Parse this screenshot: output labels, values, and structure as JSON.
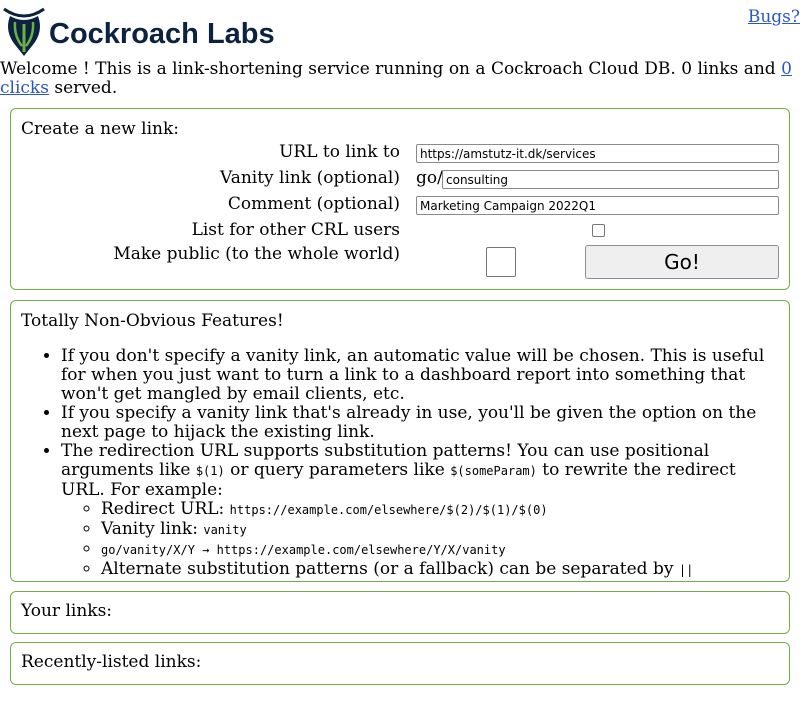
{
  "header": {
    "logo_text": "Cockroach Labs",
    "bugs_link": "Bugs?"
  },
  "welcome": {
    "text_before": "Welcome ! This is a link-shortening service running on a Cockroach Cloud DB. 0 links and ",
    "clicks_link": "0 clicks",
    "text_after": " served."
  },
  "create": {
    "title": "Create a new link:",
    "url_label": "URL to link to",
    "url_value": "https://amstutz-it.dk/services",
    "vanity_label": "Vanity link (optional)",
    "vanity_prefix": "go/",
    "vanity_value": "consulting",
    "comment_label": "Comment (optional)",
    "comment_value": "Marketing Campaign 2022Q1",
    "list_label": "List for other CRL users",
    "public_label": "Make public (to the whole world)",
    "go_button": "Go!"
  },
  "features": {
    "title": "Totally Non-Obvious Features!",
    "item1": "If you don't specify a vanity link, an automatic value will be chosen. This is useful for when you just want to turn a link to a dashboard report into something that won't get mangled by email clients, etc.",
    "item2": "If you specify a vanity link that's already in use, you'll be given the option on the next page to hijack the existing link.",
    "item3_a": "The redirection URL supports substitution patterns! You can use positional arguments like ",
    "item3_code1": "$(1)",
    "item3_b": " or query parameters like ",
    "item3_code2": "$(someParam)",
    "item3_c": " to rewrite the redirect URL. For example:",
    "sub1_label": "Redirect URL: ",
    "sub1_code": "https://example.com/elsewhere/$(2)/$(1)/$(0)",
    "sub2_label": "Vanity link: ",
    "sub2_code": "vanity",
    "sub3_code": "go/vanity/X/Y → https://example.com/elsewhere/Y/X/vanity",
    "sub4_label": "Alternate substitution patterns (or a fallback) can be separated by ",
    "sub4_code": "||"
  },
  "your_links": {
    "title": "Your links:"
  },
  "recent_links": {
    "title": "Recently-listed links:"
  },
  "colors": {
    "border_green": "#6fb042",
    "link_blue": "#2a56c6",
    "brand_navy": "#0b2240"
  }
}
